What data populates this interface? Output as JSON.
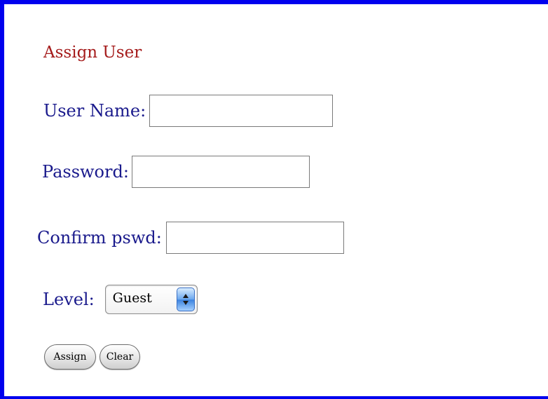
{
  "form": {
    "title": "Assign User",
    "username": {
      "label": "User Name:",
      "value": ""
    },
    "password": {
      "label": "Password:",
      "value": ""
    },
    "confirm": {
      "label": "Confirm pswd:",
      "value": ""
    },
    "level": {
      "label": "Level:",
      "selected": "Guest"
    },
    "buttons": {
      "assign": "Assign",
      "clear": "Clear"
    }
  },
  "colors": {
    "frame_border": "#0000ee",
    "title_text": "#a51c1c",
    "label_text": "#1a1a8c",
    "select_arrow": "#3b82df"
  },
  "icons": {
    "level_select": "up-down-arrows-icon"
  }
}
